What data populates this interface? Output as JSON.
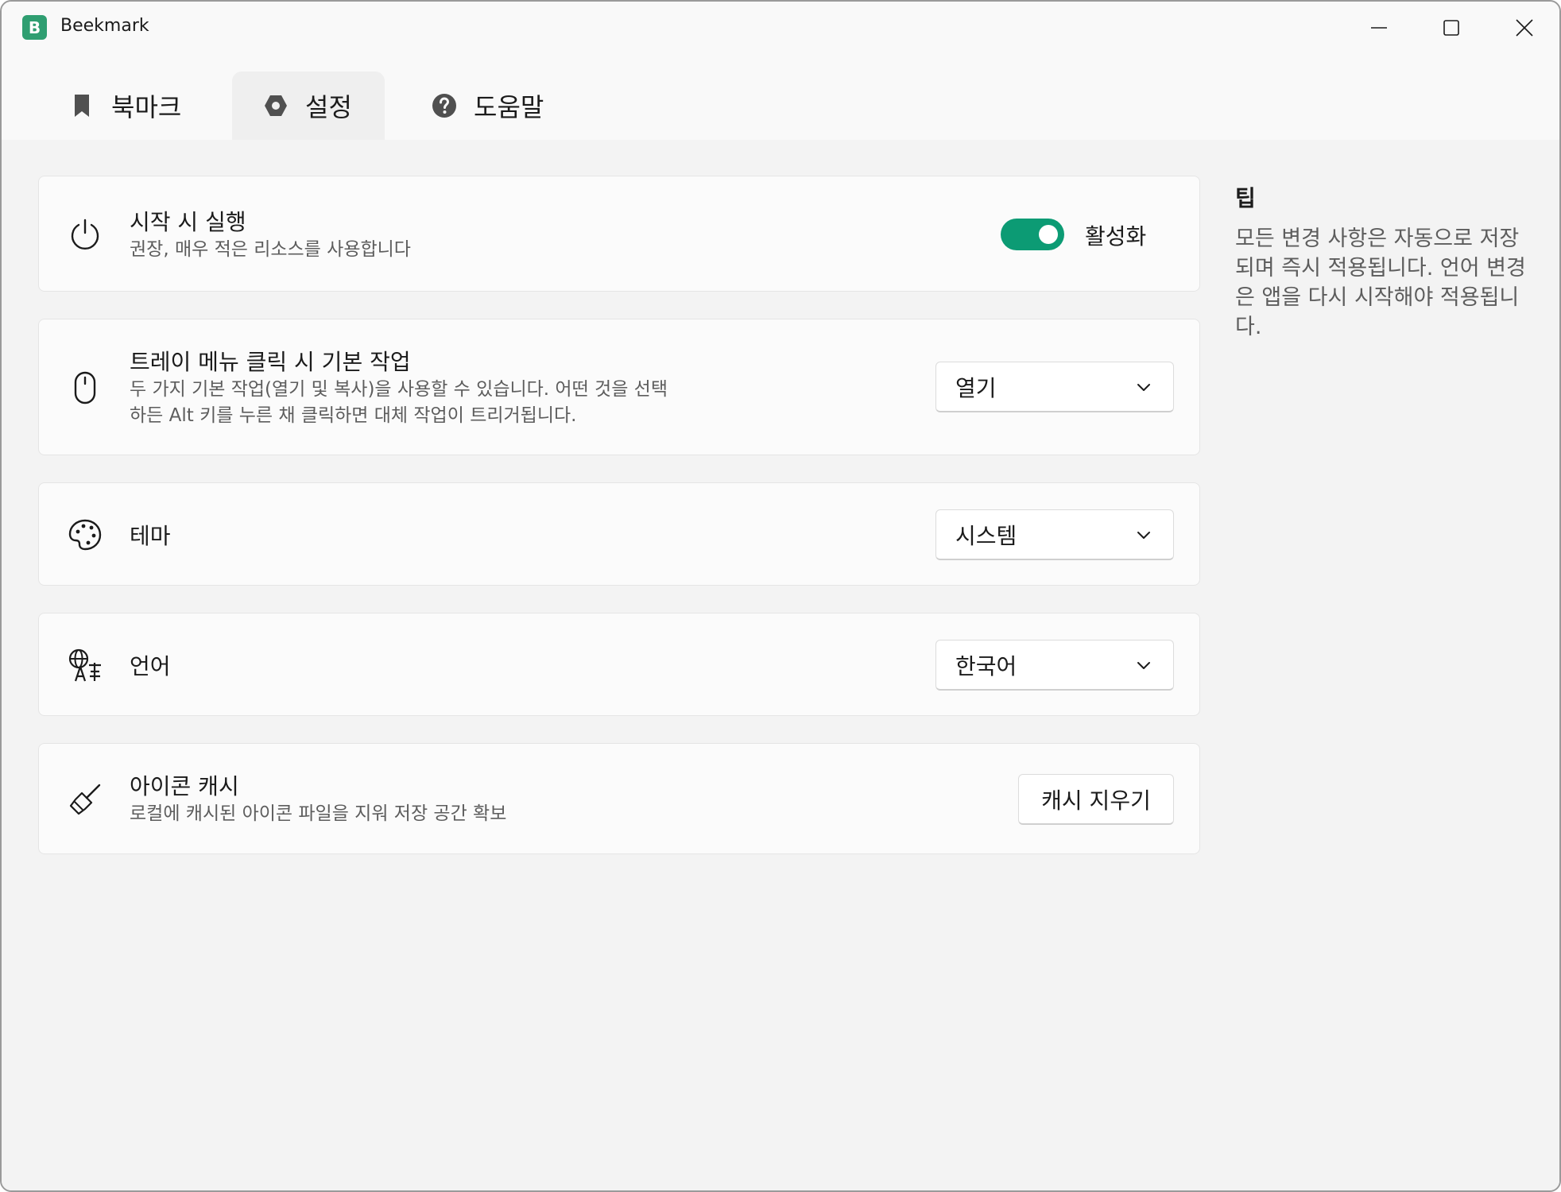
{
  "window": {
    "title": "Beekmark",
    "app_icon_letter": "B",
    "controls": {
      "minimize": "minimize-icon",
      "maximize": "maximize-icon",
      "close": "close-icon"
    }
  },
  "tabs": [
    {
      "label": "북마크",
      "icon": "bookmark-icon",
      "active": false
    },
    {
      "label": "설정",
      "icon": "settings-icon",
      "active": true
    },
    {
      "label": "도움말",
      "icon": "help-icon",
      "active": false
    }
  ],
  "settings": {
    "startup": {
      "icon": "power-icon",
      "title": "시작 시 실행",
      "description": "권장, 매우 적은 리소스를 사용합니다",
      "toggle_on": true,
      "toggle_label": "활성화"
    },
    "tray_action": {
      "icon": "mouse-icon",
      "title": "트레이 메뉴 클릭 시 기본 작업",
      "description_line1": "두 가지 기본 작업(열기 및 복사)을 사용할 수 있습니다. 어떤 것을 선택",
      "description_line2": "하든 Alt 키를 누른 채 클릭하면 대체 작업이 트리거됩니다.",
      "selected": "열기"
    },
    "theme": {
      "icon": "palette-icon",
      "title": "테마",
      "selected": "시스템"
    },
    "language": {
      "icon": "language-icon",
      "title": "언어",
      "selected": "한국어"
    },
    "icon_cache": {
      "icon": "broom-icon",
      "title": "아이콘 캐시",
      "description": "로컬에 캐시된 아이콘 파일을 지워 저장 공간 확보",
      "button_label": "캐시 지우기"
    }
  },
  "tip": {
    "title": "팁",
    "body": "모든 변경 사항은 자동으로 저장되며 즉시 적용됩니다. 언어 변경은 앱을 다시 시작해야 적용됩니다."
  },
  "colors": {
    "accent": "#0c9b74",
    "app_icon": "#2f9e71",
    "background": "#f3f3f3",
    "card": "#fbfbfb"
  }
}
